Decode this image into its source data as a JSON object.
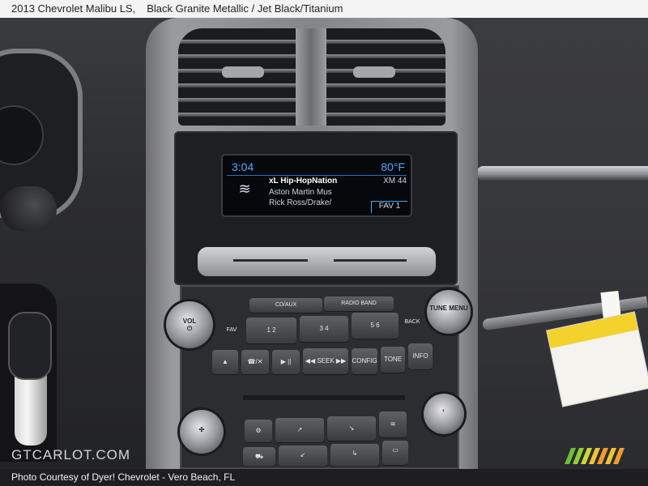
{
  "caption": {
    "vehicle": "2013 Chevrolet Malibu LS,",
    "color": "Black Granite Metallic / Jet Black/Titanium",
    "credit": "Photo Courtesy of Dyer! Chevrolet - Vero Beach, FL"
  },
  "watermark": {
    "text": "GTCARLOT.COM"
  },
  "display": {
    "time": "3:04",
    "temperature": "80°F",
    "station": "xL Hip-HopNation",
    "channel": "XM 44",
    "song": "Aston Martin Mus",
    "artist": "Rick Ross/Drake/",
    "favorite": "FAV 1",
    "icon": "xm-signal-icon"
  },
  "radio": {
    "cd_aux": "CD/AUX",
    "radio_band": "RADIO BAND",
    "vol": "VOL",
    "fav": "FAV",
    "presets": [
      "1  2",
      "3  4",
      "5  6"
    ],
    "back": "BACK",
    "tune_menu": "TUNE MENU",
    "row2": [
      "▲",
      "☎/✕",
      "▶ ||",
      "◀◀ SEEK ▶▶",
      "CONFIG",
      "TONE",
      "INFO"
    ]
  },
  "sticker": {
    "color": "#f4d22e"
  },
  "colors": {
    "screen_text": "#4aa8ff",
    "bezel": "#8e8f93"
  }
}
